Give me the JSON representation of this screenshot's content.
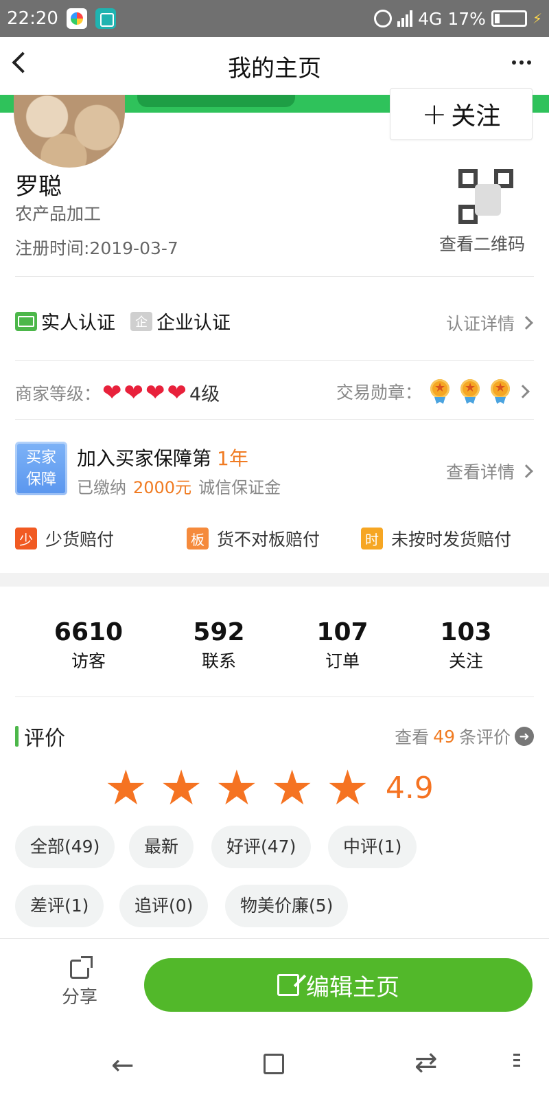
{
  "status_bar": {
    "time": "22:20",
    "network": "4G",
    "battery": "17%",
    "battery_level": 0.17
  },
  "header": {
    "title": "我的主页"
  },
  "profile": {
    "name": "罗聪",
    "category": "农产品加工",
    "register_time": "注册时间:2019-03-7",
    "follow_label": "关注",
    "qr_label": "查看二维码"
  },
  "certification": {
    "real_person": "实人认证",
    "enterprise": "企业认证",
    "details_link": "认证详情"
  },
  "level": {
    "label": "商家等级：",
    "hearts": 4,
    "value": "4级",
    "medal_label": "交易勋章：",
    "medals": 3
  },
  "guarantee": {
    "badge_line1": "买家",
    "badge_line2": "保障",
    "title": "加入买家保障第",
    "years": "1年",
    "paid_prefix": "已缴纳",
    "amount": "2000元",
    "deposit": "诚信保证金",
    "details_link": "查看详情",
    "compensations": [
      {
        "icon_char": "少",
        "label": "少货赔付",
        "color": "#f15a22"
      },
      {
        "icon_char": "板",
        "label": "货不对板赔付",
        "color": "#f58a3c"
      },
      {
        "icon_char": "时",
        "label": "未按时发货赔付",
        "color": "#f6a623"
      }
    ]
  },
  "stats": [
    {
      "num": "6610",
      "label": "访客"
    },
    {
      "num": "592",
      "label": "联系"
    },
    {
      "num": "107",
      "label": "订单"
    },
    {
      "num": "103",
      "label": "关注"
    }
  ],
  "reviews": {
    "title": "评价",
    "link_prefix": "查看",
    "count": "49",
    "link_suffix": "条评价",
    "rating": "4.9",
    "stars": 5,
    "tags": [
      "全部(49)",
      "最新",
      "好评(47)",
      "中评(1)",
      "差评(1)",
      "追评(0)",
      "物美价廉(5)"
    ]
  },
  "bottom": {
    "share_label": "分享",
    "edit_label": "编辑主页"
  }
}
